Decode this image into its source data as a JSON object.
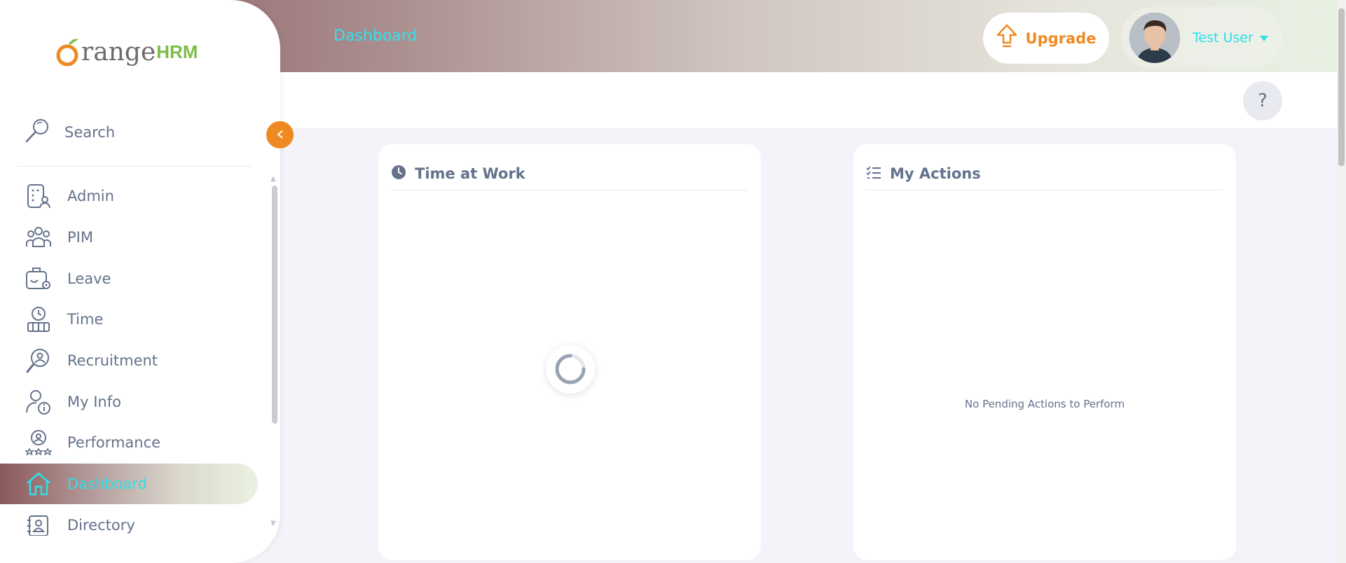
{
  "header": {
    "breadcrumb": "Dashboard",
    "upgrade_label": "Upgrade",
    "user_name": "Test User",
    "help_label": "?"
  },
  "brand": {
    "logo_text_main": "range",
    "logo_text_hrm": "HRM",
    "accent_color": "#ef8a22",
    "link_color": "#2ce0e8"
  },
  "sidebar": {
    "search_label": "Search",
    "collapse_icon": "chevron-left-icon",
    "items": [
      {
        "label": "Admin",
        "icon": "admin-icon",
        "active": false
      },
      {
        "label": "PIM",
        "icon": "pim-icon",
        "active": false
      },
      {
        "label": "Leave",
        "icon": "leave-icon",
        "active": false
      },
      {
        "label": "Time",
        "icon": "time-icon",
        "active": false
      },
      {
        "label": "Recruitment",
        "icon": "recruitment-icon",
        "active": false
      },
      {
        "label": "My Info",
        "icon": "my-info-icon",
        "active": false
      },
      {
        "label": "Performance",
        "icon": "performance-icon",
        "active": false
      },
      {
        "label": "Dashboard",
        "icon": "dashboard-icon",
        "active": true
      },
      {
        "label": "Directory",
        "icon": "directory-icon",
        "active": false
      }
    ]
  },
  "widgets": {
    "time_at_work": {
      "title": "Time at Work",
      "loading": true
    },
    "my_actions": {
      "title": "My Actions",
      "empty_text": "No Pending Actions to Perform"
    }
  }
}
